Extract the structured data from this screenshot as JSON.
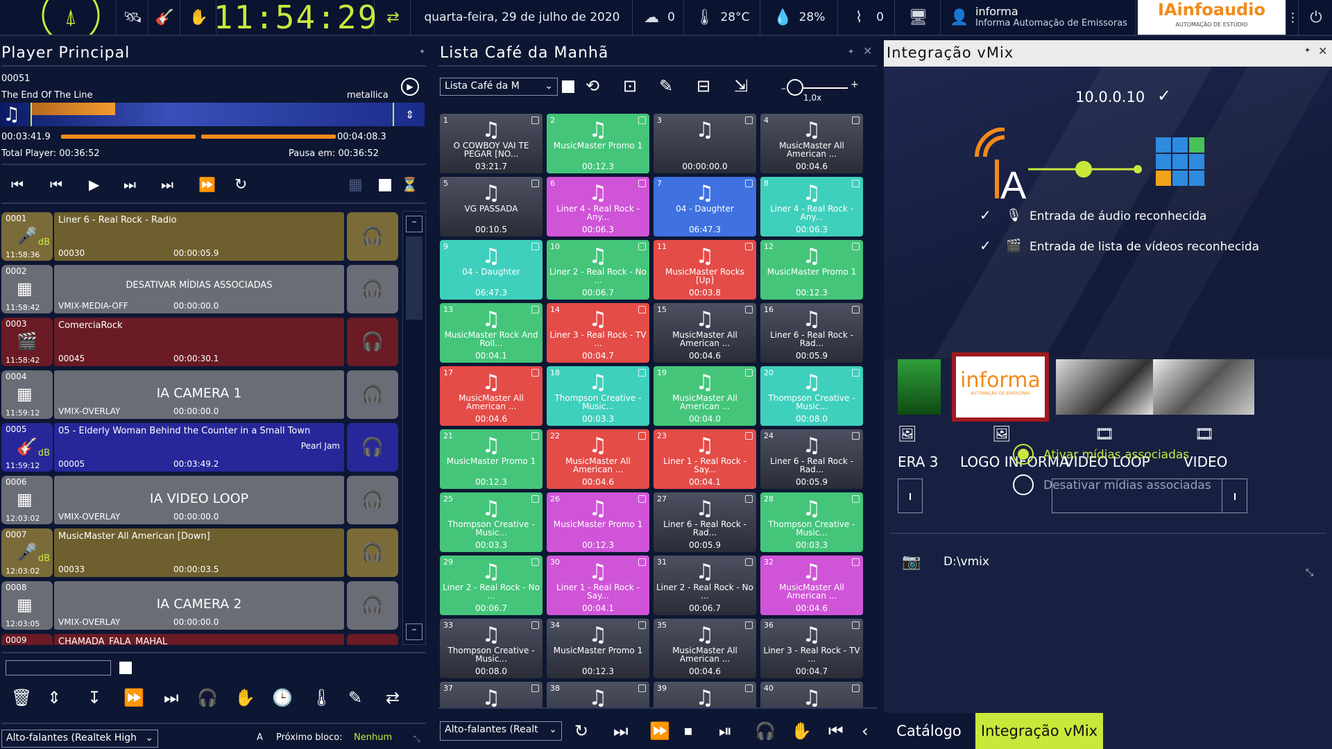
{
  "topbar": {
    "clock": "11:54:29",
    "date": "quarta-feira, 29 de julho de 2020",
    "sensor1_value": "0",
    "temperature": "28°C",
    "humidity": "28%",
    "signal_value": "0",
    "user_name": "informa",
    "user_company": "Informa Automação de Emissoras",
    "brand": "IAinfoaudio",
    "brand_sub": "AUTOMAÇÃO DE ESTÚDIO"
  },
  "player": {
    "title": "Player Principal",
    "track_number": "00051",
    "track_title": "The End Of The Line",
    "artist": "metallica",
    "elapsed": "00:03:41.9",
    "remaining": "00:04:08.3",
    "total_player": "Total Player: 00:36:52",
    "pause_at": "Pausa em: 00:36:52",
    "progress": 0.46
  },
  "playlist": [
    {
      "num": "0001",
      "time": "11:58:36",
      "title": "Liner 6 - Real Rock - Radio",
      "center": "",
      "code": "00030",
      "duration": "00:00:05.9",
      "color": "#6e5f2e",
      "numcolor": "#7a6b38",
      "icon": "🎤",
      "db": true,
      "center_size": "14px"
    },
    {
      "num": "0002",
      "time": "11:58:42",
      "title": "",
      "center": "DESATIVAR MÍDIAS ASSOCIADAS",
      "code": "VMIX-MEDIA-OFF",
      "duration": "00:00:00.0",
      "color": "#6a6d76",
      "numcolor": "#6a6d76",
      "icon": "▦",
      "db": false,
      "center_size": "13px"
    },
    {
      "num": "0003",
      "time": "11:58:42",
      "title": "ComerciaRock",
      "center": "",
      "code": "00045",
      "duration": "00:00:30.1",
      "color": "#6a1b24",
      "numcolor": "#6a1b24",
      "icon": "🎬",
      "db": false,
      "center_size": "14px"
    },
    {
      "num": "0004",
      "time": "11:59:12",
      "title": "",
      "center": "IA CAMERA 1",
      "code": "VMIX-OVERLAY",
      "duration": "00:00:00.0",
      "color": "#6a6d76",
      "numcolor": "#6a6d76",
      "icon": "▦",
      "db": false,
      "center_size": "19px"
    },
    {
      "num": "0005",
      "time": "11:59:12",
      "title": "05 - Elderly Woman Behind the Counter in a Small Town",
      "center": "Pearl Jam",
      "code": "00005",
      "duration": "00:03:49.2",
      "color": "#27279a",
      "numcolor": "#27279a",
      "icon": "🎸",
      "db": true,
      "center_size": "12px"
    },
    {
      "num": "0006",
      "time": "12:03:02",
      "title": "",
      "center": "IA VIDEO LOOP",
      "code": "VMIX-OVERLAY",
      "duration": "00:00:00.0",
      "color": "#6a6d76",
      "numcolor": "#6a6d76",
      "icon": "▦",
      "db": false,
      "center_size": "19px"
    },
    {
      "num": "0007",
      "time": "12:03:02",
      "title": "MusicMaster All American [Down]",
      "center": "",
      "code": "00033",
      "duration": "00:00:03.5",
      "color": "#6e5f2e",
      "numcolor": "#7a6b38",
      "icon": "🎤",
      "db": true,
      "center_size": "14px"
    },
    {
      "num": "0008",
      "time": "12:03:05",
      "title": "",
      "center": "IA CAMERA 2",
      "code": "VMIX-OVERLAY",
      "duration": "00:00:00.0",
      "color": "#6a6d76",
      "numcolor": "#6a6d76",
      "icon": "▦",
      "db": false,
      "center_size": "19px"
    },
    {
      "num": "0009",
      "time": "",
      "title": "CHAMADA_FALA_MAHAL",
      "center": "",
      "code": "",
      "duration": "",
      "color": "#6a1b24",
      "numcolor": "#6a1b24",
      "icon": "",
      "db": false,
      "center_size": "14px"
    }
  ],
  "left_footer": {
    "device": "Alto-falantes (Realtek High",
    "next_block_label": "Próximo bloco:",
    "next_block_value": "Nenhum"
  },
  "list": {
    "title": "Lista Café da Manhã",
    "selector": "Lista Café da M",
    "speed": "1,0x",
    "device": "Alto-falantes (Realt",
    "tiles": [
      {
        "n": "1",
        "label": "O COWBOY VAI TE PEGAR [NO...",
        "dur": "03:21.7",
        "cls": "k"
      },
      {
        "n": "2",
        "label": "MusicMaster Promo 1",
        "dur": "00:12.3",
        "cls": "g"
      },
      {
        "n": "3",
        "label": "",
        "dur": "00:00:00.0",
        "cls": "k"
      },
      {
        "n": "4",
        "label": "MusicMaster All American ...",
        "dur": "00:04.6",
        "cls": "k"
      },
      {
        "n": "5",
        "label": "VG PASSADA",
        "dur": "00:10.5",
        "cls": "k"
      },
      {
        "n": "6",
        "label": "Liner 4 - Real Rock - Any...",
        "dur": "00:06.3",
        "cls": "m"
      },
      {
        "n": "7",
        "label": "04 - Daughter",
        "dur": "06:47.3",
        "cls": "b"
      },
      {
        "n": "8",
        "label": "Liner 4 - Real Rock - Any...",
        "dur": "00:06.3",
        "cls": "c"
      },
      {
        "n": "9",
        "label": "04 - Daughter",
        "dur": "06:47.3",
        "cls": "c"
      },
      {
        "n": "10",
        "label": "Liner 2 - Real Rock - No ...",
        "dur": "00:06.7",
        "cls": "g"
      },
      {
        "n": "11",
        "label": "MusicMaster Rocks [Up]",
        "dur": "00:03.8",
        "cls": "r"
      },
      {
        "n": "12",
        "label": "MusicMaster Promo 1",
        "dur": "00:12.3",
        "cls": "g"
      },
      {
        "n": "13",
        "label": "MusicMaster Rock And Roll...",
        "dur": "00:04.1",
        "cls": "g"
      },
      {
        "n": "14",
        "label": "Liner 3 - Real Rock - TV ...",
        "dur": "00:04.7",
        "cls": "r"
      },
      {
        "n": "15",
        "label": "MusicMaster All American ...",
        "dur": "00:04.6",
        "cls": "k"
      },
      {
        "n": "16",
        "label": "Liner 6 - Real Rock - Rad...",
        "dur": "00:05.9",
        "cls": "k"
      },
      {
        "n": "17",
        "label": "MusicMaster All American ...",
        "dur": "00:04.6",
        "cls": "r"
      },
      {
        "n": "18",
        "label": "Thompson Creative - Music...",
        "dur": "00:03.3",
        "cls": "c"
      },
      {
        "n": "19",
        "label": "MusicMaster All American ...",
        "dur": "00:04.0",
        "cls": "g"
      },
      {
        "n": "20",
        "label": "Thompson Creative - Music...",
        "dur": "00:08.0",
        "cls": "c"
      },
      {
        "n": "21",
        "label": "MusicMaster Promo 1",
        "dur": "00:12.3",
        "cls": "g"
      },
      {
        "n": "22",
        "label": "MusicMaster All American ...",
        "dur": "00:04.6",
        "cls": "r"
      },
      {
        "n": "23",
        "label": "Liner 1 - Real Rock - Say...",
        "dur": "00:04.1",
        "cls": "r"
      },
      {
        "n": "24",
        "label": "Liner 6 - Real Rock - Rad...",
        "dur": "00:05.9",
        "cls": "k"
      },
      {
        "n": "25",
        "label": "Thompson Creative - Music...",
        "dur": "00:03.3",
        "cls": "g"
      },
      {
        "n": "26",
        "label": "MusicMaster Promo 1",
        "dur": "00:12.3",
        "cls": "m"
      },
      {
        "n": "27",
        "label": "Liner 6 - Real Rock - Rad...",
        "dur": "00:05.9",
        "cls": "k"
      },
      {
        "n": "28",
        "label": "Thompson Creative - Music...",
        "dur": "00:03.3",
        "cls": "g"
      },
      {
        "n": "29",
        "label": "Liner 2 - Real Rock - No ...",
        "dur": "00:06.7",
        "cls": "g"
      },
      {
        "n": "30",
        "label": "Liner 1 - Real Rock - Say...",
        "dur": "00:04.1",
        "cls": "m"
      },
      {
        "n": "31",
        "label": "Liner 2 - Real Rock - No ...",
        "dur": "00:06.7",
        "cls": "k"
      },
      {
        "n": "32",
        "label": "MusicMaster All American ...",
        "dur": "00:04.6",
        "cls": "m"
      },
      {
        "n": "33",
        "label": "Thompson Creative - Music...",
        "dur": "00:08.0",
        "cls": "k"
      },
      {
        "n": "34",
        "label": "MusicMaster Promo 1",
        "dur": "00:12.3",
        "cls": "k"
      },
      {
        "n": "35",
        "label": "MusicMaster All American ...",
        "dur": "00:04.6",
        "cls": "k"
      },
      {
        "n": "36",
        "label": "Liner 3 - Real Rock - TV ...",
        "dur": "00:04.7",
        "cls": "k"
      },
      {
        "n": "37",
        "label": "",
        "dur": "",
        "cls": "k"
      },
      {
        "n": "38",
        "label": "",
        "dur": "",
        "cls": "k"
      },
      {
        "n": "39",
        "label": "",
        "dur": "",
        "cls": "k"
      },
      {
        "n": "40",
        "label": "",
        "dur": "",
        "cls": "k"
      }
    ]
  },
  "vmix": {
    "title": "Integração vMix",
    "ip": "10.0.0.10",
    "audio_ok": "Entrada de áudio reconhecida",
    "video_ok": "Entrada de lista de vídeos reconhecida",
    "media": [
      {
        "label": "ERA 3"
      },
      {
        "label": "LOGO INFORMA"
      },
      {
        "label": "VIDEO LOOP"
      },
      {
        "label": "VIDEO"
      }
    ],
    "logo_text": "informa",
    "logo_sub": "AUTOMAÇÃO DE EMISSORAS",
    "opt_on": "Ativar mídias associadas",
    "opt_off": "Desativar mídias associadas",
    "path": "D:\\vmix",
    "tab_catalog": "Catálogo",
    "tab_vmix": "Integração vMix"
  },
  "colors": {
    "accent": "#c8e83b",
    "tab_active": "#c8e83b",
    "bg": "#0d1733"
  }
}
